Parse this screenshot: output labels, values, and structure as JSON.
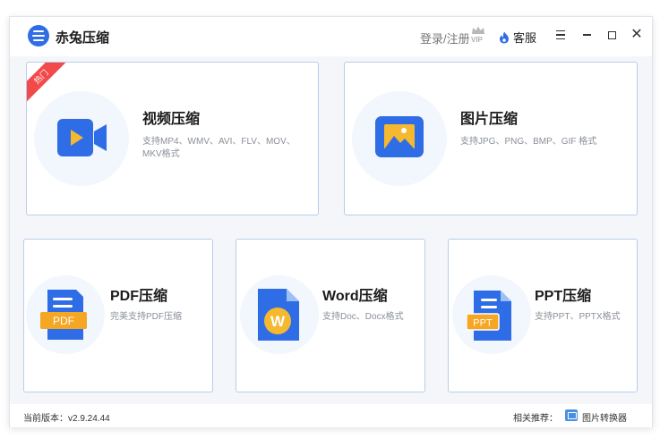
{
  "app": {
    "title": "赤兔压缩"
  },
  "header": {
    "login_label": "登录/注册",
    "vip_label": "VIP",
    "service_label": "客服"
  },
  "cards": {
    "video": {
      "hot_label": "热门",
      "title": "视频压缩",
      "desc": "支持MP4、WMV、AVI、FLV、MOV、MKV格式"
    },
    "image": {
      "title": "图片压缩",
      "desc": "支持JPG、PNG、BMP、GIF 格式"
    },
    "pdf": {
      "title": "PDF压缩",
      "desc": "完美支持PDF压缩",
      "icon_text": "PDF"
    },
    "word": {
      "title": "Word压缩",
      "desc": "支持Doc、Docx格式",
      "icon_text": "W"
    },
    "ppt": {
      "title": "PPT压缩",
      "desc": "支持PPT、PPTX格式",
      "icon_text": "PPT"
    }
  },
  "footer": {
    "version_label": "当前版本：v2.9.24.44",
    "related_label": "相关推荐：",
    "converter_label": "图片转换器"
  },
  "colors": {
    "accent": "#2f6de6",
    "hot": "#f24a4a",
    "pdf_badge": "#f5a623",
    "word_badge": "#f5b82e",
    "card_border": "#b9cde8"
  }
}
